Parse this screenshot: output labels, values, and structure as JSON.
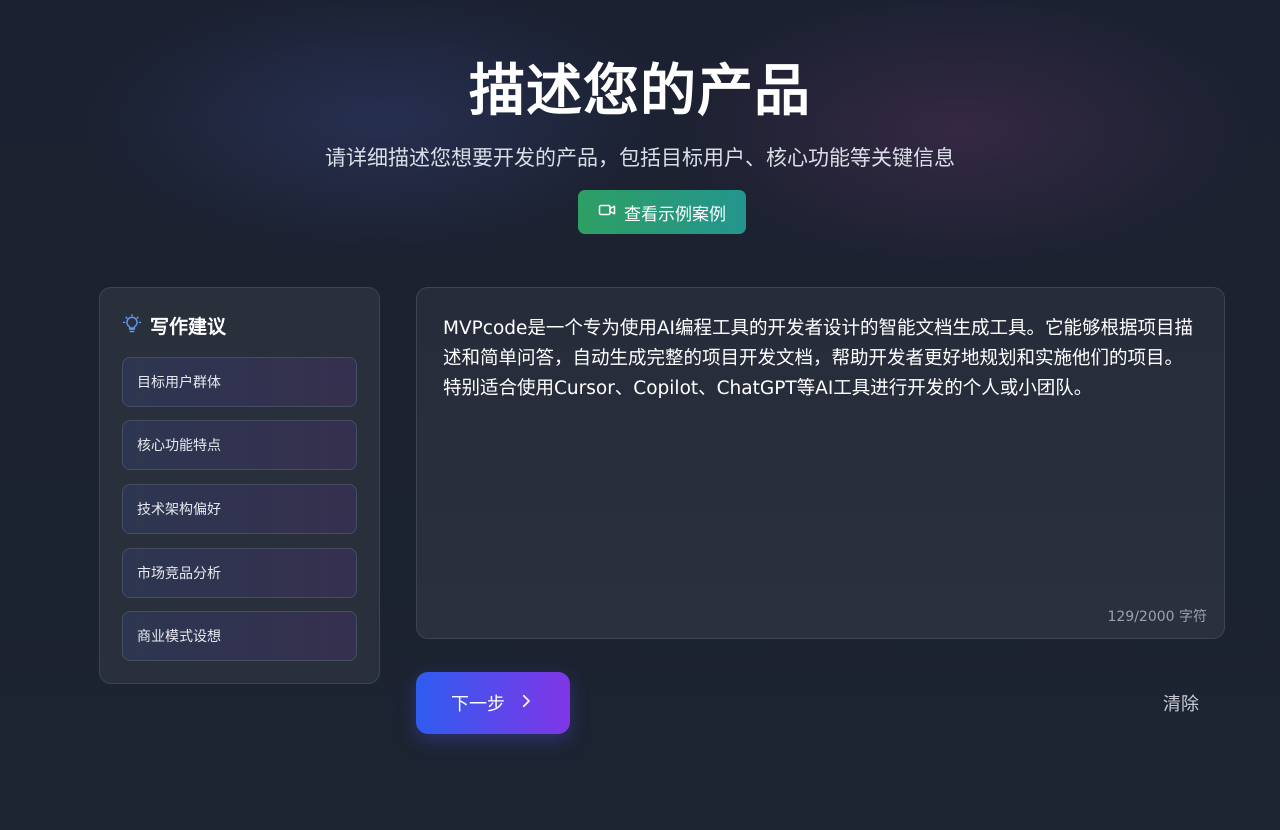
{
  "header": {
    "title": "描述您的产品",
    "subtitle": "请详细描述您想要开发的产品，包括目标用户、核心功能等关键信息",
    "example_button": {
      "label": "查看示例案例",
      "icon": "video-camera-icon"
    }
  },
  "tips": {
    "title": "写作建议",
    "icon": "lightbulb-icon",
    "items": [
      {
        "label": "目标用户群体"
      },
      {
        "label": "核心功能特点"
      },
      {
        "label": "技术架构偏好"
      },
      {
        "label": "市场竞品分析"
      },
      {
        "label": "商业模式设想"
      }
    ]
  },
  "editor": {
    "value": "MVPcode是一个专为使用AI编程工具的开发者设计的智能文档生成工具。它能够根据项目描述和简单问答，自动生成完整的项目开发文档，帮助开发者更好地规划和实施他们的项目。特别适合使用Cursor、Copilot、ChatGPT等AI工具进行开发的个人或小团队。",
    "counter": "129/2000 字符"
  },
  "actions": {
    "next_label": "下一步",
    "next_icon": "chevron-right-icon",
    "clear_label": "清除"
  },
  "colors": {
    "background": "#1a202c",
    "example_button": "#2e9f64",
    "next_button_start": "#2f5cf0",
    "next_button_end": "#8036e6",
    "tip_icon": "#5b9cf5"
  }
}
